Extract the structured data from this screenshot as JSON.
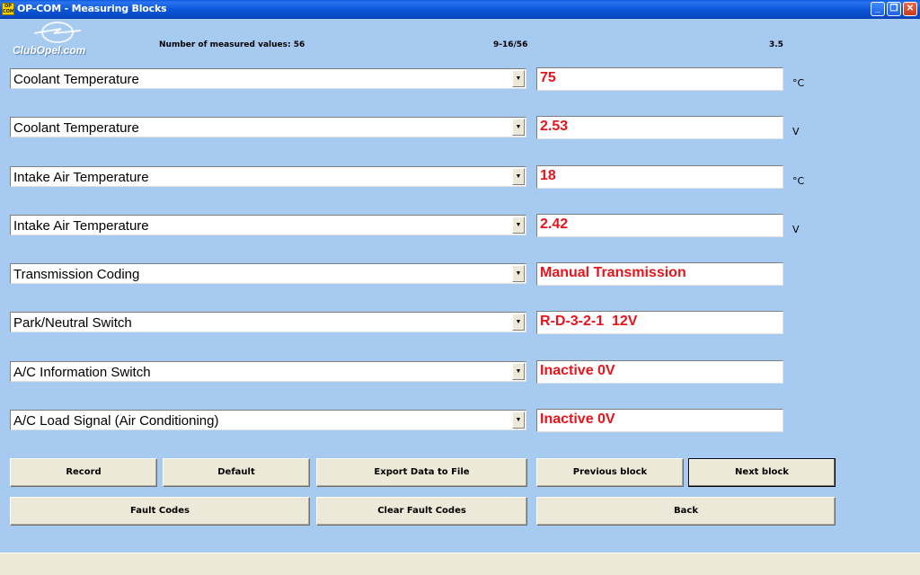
{
  "window": {
    "title": "OP-COM - Measuring Blocks",
    "icon_text": "OP COM",
    "minimize": "_",
    "restore": "❐",
    "close": "✕"
  },
  "logo": {
    "text": "ClubOpel.com"
  },
  "info": {
    "measured_count": "Number of measured values: 56",
    "range": "9-16/56",
    "version": "3.5"
  },
  "rows": [
    {
      "label": "Coolant Temperature",
      "value": "75",
      "unit": "°C"
    },
    {
      "label": "Coolant Temperature",
      "value": "2.53",
      "unit": "V"
    },
    {
      "label": "Intake Air Temperature",
      "value": "18",
      "unit": "°C"
    },
    {
      "label": "Intake Air Temperature",
      "value": "2.42",
      "unit": "V"
    },
    {
      "label": "Transmission Coding",
      "value": "Manual Transmission",
      "unit": ""
    },
    {
      "label": "Park/Neutral Switch",
      "value": "R-D-3-2-1  12V",
      "unit": ""
    },
    {
      "label": "A/C Information Switch",
      "value": "Inactive 0V",
      "unit": ""
    },
    {
      "label": "A/C Load Signal (Air Conditioning)",
      "value": "Inactive 0V",
      "unit": ""
    }
  ],
  "dropdown_arrow": "▼",
  "buttons": {
    "record": "Record",
    "default": "Default",
    "export": "Export Data to File",
    "previous": "Previous block",
    "next": "Next block",
    "fault_codes": "Fault Codes",
    "clear_fault_codes": "Clear Fault Codes",
    "back": "Back"
  },
  "colors": {
    "background": "#a6caf0",
    "value_text": "#e8141c",
    "button_face": "#ece9d8",
    "titlebar": "#0a56d8"
  }
}
